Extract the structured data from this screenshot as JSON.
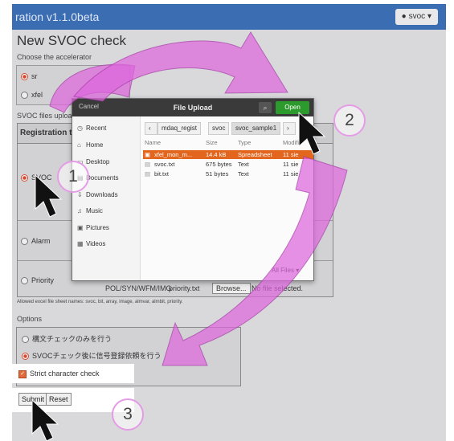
{
  "app": {
    "title": "ration v1.1.0beta",
    "user_button": "svoc",
    "user_icon": "user-icon",
    "page_title": "New SVOC check"
  },
  "accelerator": {
    "label": "Choose the accelerator",
    "options": [
      "sr",
      "xfel"
    ],
    "selected": "sr"
  },
  "files": {
    "label": "SVOC files uploa",
    "header": "Registration ty",
    "rows": [
      {
        "type": "SVOC",
        "selected": true
      },
      {
        "type": "Alarm",
        "selected": false
      },
      {
        "type": "Priority",
        "selected": false
      }
    ],
    "bottom_type": "POL/SYN/WFM/IMG",
    "bottom_file": "priority.txt",
    "browse_label": "Browse...",
    "no_file": "No file selected.",
    "allowed_note": "Allowed excel file sheet names: svoc, bit, array, image, almvar, almbit, priority."
  },
  "options": {
    "label": "Options",
    "items": [
      "構文チェックのみを行う",
      "SVOCチェック後に信号登録依頼を行う"
    ],
    "selected_index": 1,
    "strict_label": "Strict character check",
    "strict_checked": true
  },
  "actions": {
    "submit": "Submit",
    "reset": "Reset"
  },
  "dialog": {
    "title": "File Upload",
    "cancel": "Cancel",
    "open": "Open",
    "sidebar": [
      {
        "label": "Recent",
        "icon": "clock-icon"
      },
      {
        "label": "Home",
        "icon": "home-icon"
      },
      {
        "label": "Desktop",
        "icon": "desktop-icon"
      },
      {
        "label": "Documents",
        "icon": "document-icon"
      },
      {
        "label": "Downloads",
        "icon": "download-icon"
      },
      {
        "label": "Music",
        "icon": "music-icon"
      },
      {
        "label": "Pictures",
        "icon": "picture-icon"
      },
      {
        "label": "Videos",
        "icon": "video-icon"
      }
    ],
    "breadcrumbs": [
      "mdaq_regist",
      "svoc",
      "svoc_sample1"
    ],
    "columns": [
      "Name",
      "Size",
      "Type",
      "Modifi"
    ],
    "files": [
      {
        "name": "xfel_mon_m...",
        "size": "14.4 kB",
        "type": "Spreadsheet",
        "modified": "11 sie",
        "selected": true
      },
      {
        "name": "svoc.txt",
        "size": "675 bytes",
        "type": "Text",
        "modified": "11 sie",
        "selected": false
      },
      {
        "name": "bit.txt",
        "size": "51 bytes",
        "type": "Text",
        "modified": "11 sie",
        "selected": false
      }
    ],
    "filter": "All Files"
  },
  "steps": [
    "1",
    "2",
    "3"
  ],
  "colors": {
    "navbar": "#3b6db3",
    "open_button": "#2d9a2d",
    "selection": "#e3661f",
    "arrow": "#dd66dd"
  }
}
